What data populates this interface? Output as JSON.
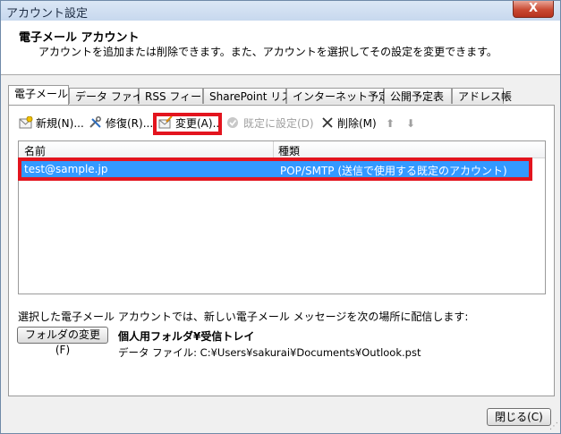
{
  "window": {
    "title": "アカウント設定",
    "close_glyph": "X"
  },
  "header": {
    "title": "電子メール アカウント",
    "description": "アカウントを追加または削除できます。また、アカウントを選択してその設定を変更できます。"
  },
  "tabs": [
    {
      "label": "電子メール",
      "active": true
    },
    {
      "label": "データ ファイル",
      "active": false
    },
    {
      "label": "RSS フィード",
      "active": false
    },
    {
      "label": "SharePoint リスト",
      "active": false
    },
    {
      "label": "インターネット予定表",
      "active": false
    },
    {
      "label": "公開予定表",
      "active": false
    },
    {
      "label": "アドレス帳",
      "active": false
    }
  ],
  "toolbar": {
    "new_label": "新規(N)...",
    "repair_label": "修復(R)...",
    "change_label": "変更(A)...",
    "default_label": "既定に設定(D)",
    "delete_label": "削除(M)",
    "up_glyph": "⬆",
    "down_glyph": "⬇"
  },
  "list": {
    "columns": [
      "名前",
      "種類"
    ],
    "rows": [
      {
        "name": "test@sample.jp",
        "type": "POP/SMTP (送信で使用する既定のアカウント)",
        "selected": true
      }
    ]
  },
  "delivery": {
    "text": "選択した電子メール アカウントでは、新しい電子メール メッセージを次の場所に配信します:",
    "button_label": "フォルダの変更(F)",
    "folder": "個人用フォルダ¥受信トレイ",
    "data_file": "データ ファイル: C:¥Users¥sakurai¥Documents¥Outlook.pst"
  },
  "footer": {
    "close_label": "閉じる(C)"
  },
  "colors": {
    "highlight": "#e3141e",
    "selection": "#3399ff"
  }
}
